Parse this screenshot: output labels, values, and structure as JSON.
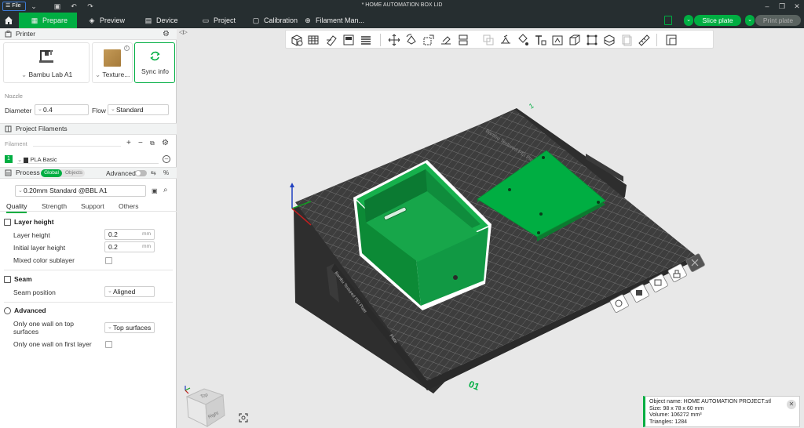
{
  "titlebar": {
    "file_label": "File",
    "document_title": "* HOME AUTOMATION BOX LID"
  },
  "nav": {
    "tabs": [
      "Prepare",
      "Preview",
      "Device",
      "Project",
      "Calibration",
      "Filament Man..."
    ],
    "slice_label": "Slice plate",
    "print_label": "Print plate"
  },
  "printer": {
    "section": "Printer",
    "model": "Bambu Lab A1",
    "plate": "Texture...",
    "sync": "Sync info",
    "nozzle_title": "Nozzle",
    "diameter_label": "Diameter",
    "diameter": "0.4",
    "flow_label": "Flow",
    "flow": "Standard"
  },
  "filaments": {
    "section": "Project Filaments",
    "list_label": "Filament",
    "items": [
      {
        "index": "1",
        "name": "PLA Basic",
        "color": "#00ae42"
      }
    ]
  },
  "process": {
    "section": "Process",
    "global": "Global",
    "objects": "Objects",
    "advanced": "Advanced",
    "preset": "0.20mm Standard @BBL A1",
    "tabs": [
      "Quality",
      "Strength",
      "Support",
      "Others"
    ],
    "layer_height_title": "Layer height",
    "layer_height_label": "Layer height",
    "layer_height": "0.2",
    "initial_layer_label": "Initial layer height",
    "initial_layer": "0.2",
    "unit": "mm",
    "mixed_label": "Mixed color sublayer",
    "seam_title": "Seam",
    "seam_position_label": "Seam position",
    "seam_position": "Aligned",
    "advanced_title": "Advanced",
    "one_wall_top_label": "Only one wall on top surfaces",
    "one_wall_top": "Top surfaces",
    "one_wall_first_label": "Only one wall on first layer"
  },
  "plate": {
    "number": "01",
    "label_back": "Bambu Textured PEI Plate",
    "label_front": "Bambu Textured PEI Plate",
    "plate_side_tag": "Plate"
  },
  "viewcube": {
    "top": "Top",
    "right": "Right"
  },
  "object_info": {
    "name": "Object name: HOME AUTOMATION PROJECT.stl",
    "size": "Size: 98 x 78 x 60 mm",
    "volume": "Volume: 106272 mm³",
    "triangles": "Triangles: 1284"
  },
  "colors": {
    "accent": "#00ae42",
    "bar": "#262e30",
    "bed": "#3a3a3a"
  }
}
